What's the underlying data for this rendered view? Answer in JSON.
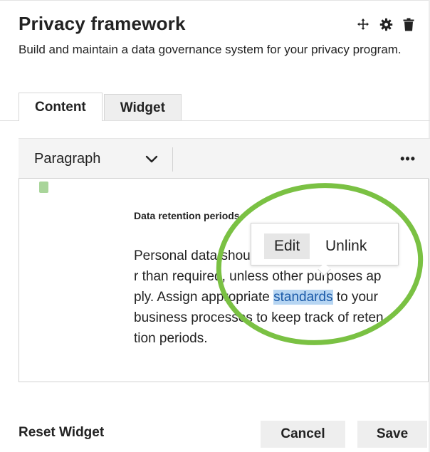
{
  "header": {
    "title": "Privacy framework",
    "subtitle": "Build and maintain a data governance system for your privacy program.",
    "icons": [
      "move-icon",
      "gear-icon",
      "trash-icon"
    ]
  },
  "tabs": [
    {
      "label": "Content",
      "active": true
    },
    {
      "label": "Widget",
      "active": false
    }
  ],
  "toolbar": {
    "format_value": "Paragraph",
    "more_label": "•••"
  },
  "editor": {
    "heading": "Data retention periods",
    "lines": [
      {
        "before": "Personal data should not be retained longe",
        "link": "",
        "after": ""
      },
      {
        "before": "r than required, unless other purposes ap",
        "link": "",
        "after": ""
      },
      {
        "before": "ply. Assign appropriate ",
        "link": "standards",
        "after": " to your"
      },
      {
        "before": "business processes to keep track of reten",
        "link": "",
        "after": ""
      },
      {
        "before": "tion periods.",
        "link": "",
        "after": ""
      }
    ],
    "link_popup": {
      "edit_label": "Edit",
      "unlink_label": "Unlink"
    }
  },
  "footer": {
    "reset_label": "Reset Widget",
    "cancel_label": "Cancel",
    "save_label": "Save"
  },
  "colors": {
    "annotation_ring": "#7ac143",
    "link_highlight": "#b6d5f2",
    "link_text": "#1a5aa8"
  }
}
